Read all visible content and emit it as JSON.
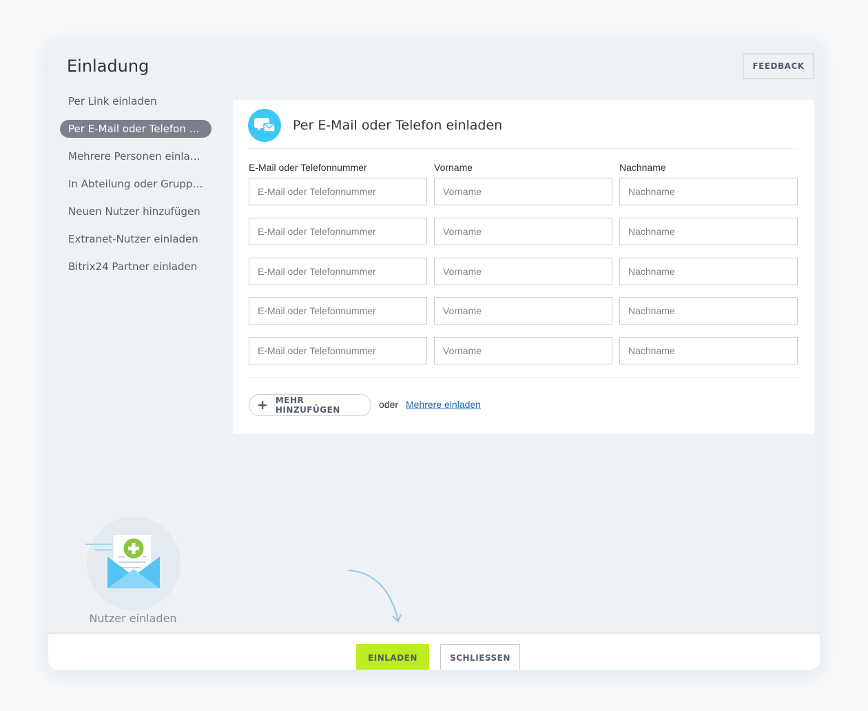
{
  "header": {
    "title": "Einladung",
    "feedback_label": "FEEDBACK"
  },
  "sidebar": {
    "items": [
      {
        "label": "Per Link einladen",
        "active": false
      },
      {
        "label": "Per E-Mail oder Telefon e...",
        "active": true
      },
      {
        "label": "Mehrere Personen einlad...",
        "active": false
      },
      {
        "label": "In Abteilung oder Gruppe...",
        "active": false
      },
      {
        "label": "Neuen Nutzer hinzufügen",
        "active": false
      },
      {
        "label": "Extranet-Nutzer einladen",
        "active": false
      },
      {
        "label": "Bitrix24 Partner einladen",
        "active": false
      }
    ]
  },
  "panel": {
    "title": "Per E-Mail oder Telefon einladen",
    "icon": "chat-mail-icon",
    "columns": [
      "E-Mail oder Telefonnummer",
      "Vorname",
      "Nachname"
    ],
    "placeholders": {
      "contact": "E-Mail oder Telefonnummer",
      "first_name": "Vorname",
      "last_name": "Nachname"
    },
    "row_count": 5,
    "add_more_label": "MEHR HINZUFÜGEN",
    "or_label": "oder",
    "bulk_link_label": "Mehrere einladen"
  },
  "illustration": {
    "icon": "envelope-plus-icon",
    "caption": "Nutzer einladen"
  },
  "footer": {
    "invite_label": "EINLADEN",
    "close_label": "SCHLIESSEN"
  },
  "colors": {
    "accent_green": "#bbed21",
    "icon_blue": "#3bc8f5",
    "link_blue": "#2067b0",
    "active_item_bg": "#79818b"
  }
}
